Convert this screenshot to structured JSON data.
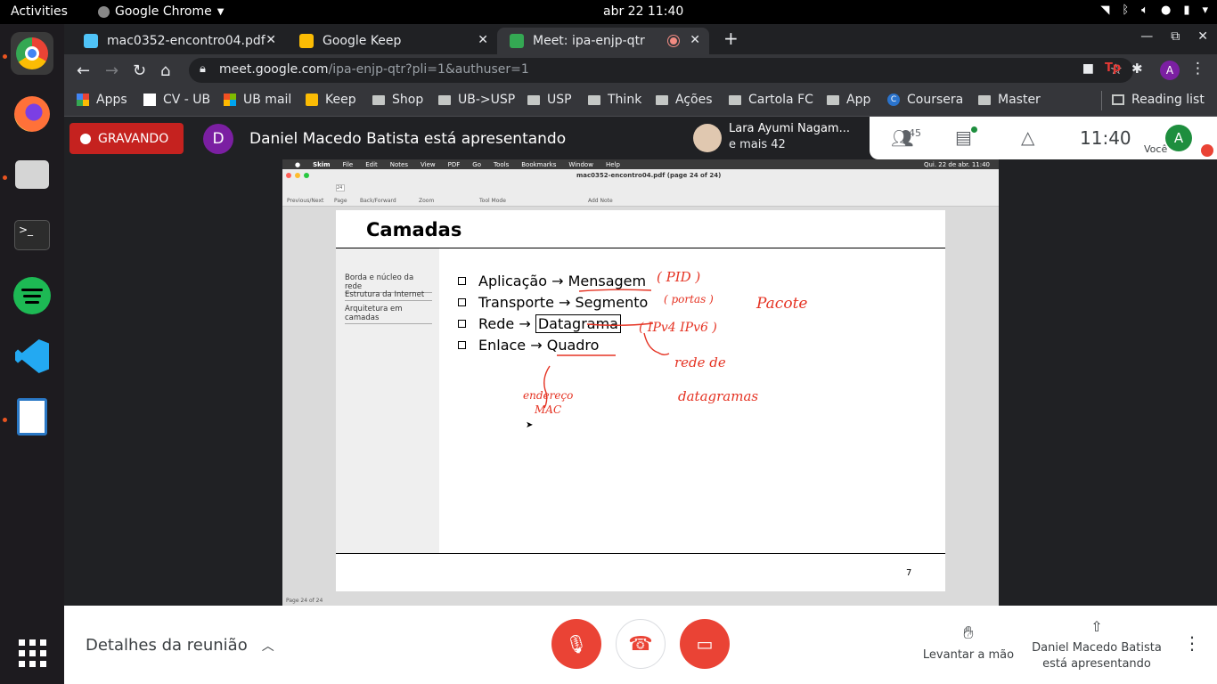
{
  "topbar": {
    "activities": "Activities",
    "app": "Google Chrome",
    "datetime": "abr 22  11:40"
  },
  "tabs": [
    {
      "title": "mac0352-encontro04.pdf",
      "color": "#4fc3f7"
    },
    {
      "title": "Google Keep",
      "color": "#fbbc04"
    },
    {
      "title": "Meet: ipa-enjp-qtr",
      "color": "#34a853"
    }
  ],
  "address": {
    "host": "meet.google.com",
    "path": "/ipa-enjp-qtr?pli=1&authuser=1"
  },
  "bookmarks": [
    "Apps",
    "CV - UB",
    "UB mail",
    "Keep",
    "Shop",
    "UB->USP",
    "USP",
    "Think",
    "Ações",
    "Cartola FC",
    "App",
    "Coursera",
    "Master"
  ],
  "reading_list": "Reading list",
  "profile_initial": "A",
  "meet": {
    "recording": "GRAVANDO",
    "presenter_initial": "D",
    "presenter_text": "Daniel Macedo Batista está apresentando",
    "participant_name": "Lara Ayumi Nagam...",
    "participant_more": "e mais 42",
    "people_count": "45",
    "time": "11:40",
    "self_label": "Você",
    "self_initial": "A"
  },
  "skim": {
    "menu": [
      "Skim",
      "File",
      "Edit",
      "Notes",
      "View",
      "PDF",
      "Go",
      "Tools",
      "Bookmarks",
      "Window",
      "Help"
    ],
    "menu_clock": "Qui. 22 de abr.  11:40",
    "window_title": "mac0352-encontro04.pdf (page 24 of 24)",
    "toolbar_labels": [
      "Previous/Next",
      "Page",
      "Back/Forward",
      "Zoom",
      "Tool Mode",
      "Add Note"
    ],
    "page_field": "24",
    "status": "Page 24 of 24"
  },
  "slide": {
    "title": "Camadas",
    "nav": [
      "Borda e núcleo da rede",
      "Estrutura da Internet",
      "Arquitetura em camadas"
    ],
    "bullets": [
      {
        "left": "Aplicação",
        "right": "Mensagem"
      },
      {
        "left": "Transporte",
        "right": "Segmento"
      },
      {
        "left": "Rede",
        "right": "Datagrama"
      },
      {
        "left": "Enlace",
        "right": "Quadro"
      }
    ],
    "arrow": "→",
    "page": "7",
    "ink": [
      "( PID )",
      "( portas )",
      "Pacote",
      "( IPv4  IPv6 )",
      "rede de",
      "datagramas",
      "endereço",
      "MAC"
    ]
  },
  "controls": {
    "details": "Detalhes da reunião",
    "raise_hand": "Levantar a mão",
    "presenting": "Daniel Macedo Batista está apresentando"
  }
}
